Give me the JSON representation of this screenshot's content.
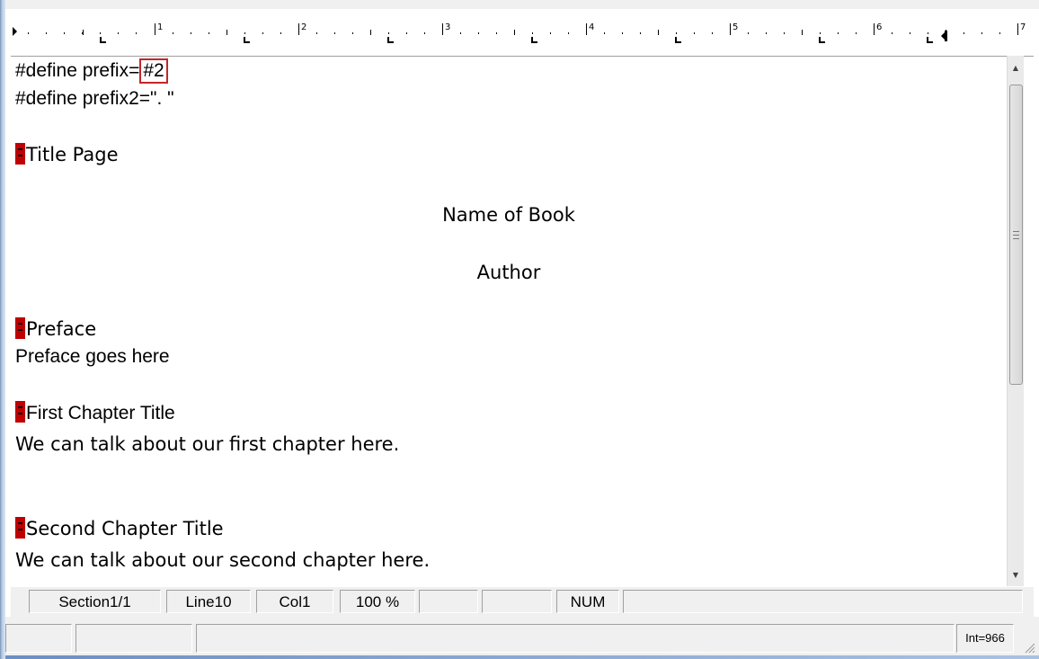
{
  "ruler": {
    "numbers": [
      "1",
      "2",
      "3",
      "4",
      "5",
      "6",
      "7"
    ]
  },
  "editor": {
    "define1_prefix": "#define prefix=",
    "define1_value": "#2",
    "define2": "#define prefix2=\". \"",
    "title_page": "Title Page",
    "book_name": "Name of Book",
    "author": "Author",
    "preface_heading": "Preface",
    "preface_text": "Preface goes here",
    "chapter1_heading": "First Chapter Title",
    "chapter1_text": "We can talk about our first chapter here.",
    "chapter2_heading": "Second Chapter Title",
    "chapter2_text": "We can talk about our second chapter here."
  },
  "status": {
    "section": "Section1/1",
    "line": "Line10",
    "col": "Col1",
    "zoom": "100 %",
    "num": "NUM",
    "int_label": "Int=966"
  },
  "colors": {
    "marker": "#c00000",
    "highlight_border": "#c0282a"
  }
}
